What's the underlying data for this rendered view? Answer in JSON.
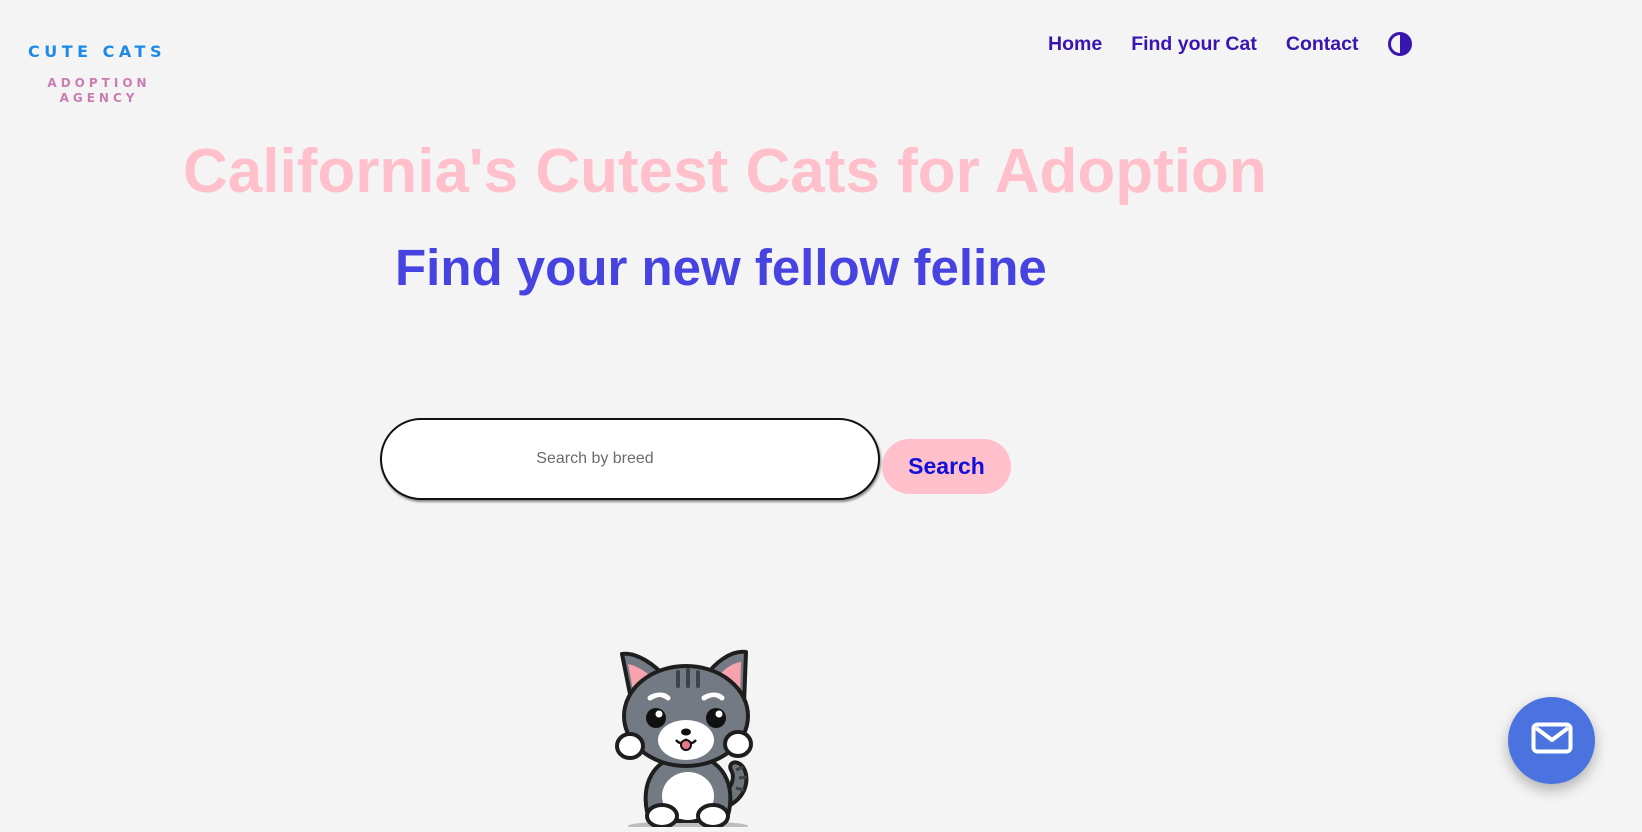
{
  "logo": {
    "title": "CUTE CATS",
    "subtitle": "ADOPTION AGENCY"
  },
  "nav": {
    "items": [
      {
        "label": "Home"
      },
      {
        "label": "Find your Cat"
      },
      {
        "label": "Contact"
      }
    ],
    "theme_toggle_icon": "half-circle-contrast-icon"
  },
  "hero": {
    "title": "California's Cutest Cats for Adoption",
    "subtitle": "Find your new fellow feline"
  },
  "search": {
    "placeholder": "Search by breed",
    "value": "",
    "button_label": "Search"
  },
  "illustration": {
    "icon": "cartoon-cat-illustration"
  },
  "contact_fab": {
    "icon": "envelope-icon"
  },
  "colors": {
    "background": "#f4f4f4",
    "logo_title": "#1e8ae6",
    "logo_subtitle": "#c97db2",
    "nav_link": "#3a16b0",
    "hero_title": "#ffc0cb",
    "hero_subtitle": "#4643e0",
    "search_button_bg": "#ffc0cb",
    "search_button_text": "#1010d8",
    "fab_bg": "#4a73e0"
  }
}
